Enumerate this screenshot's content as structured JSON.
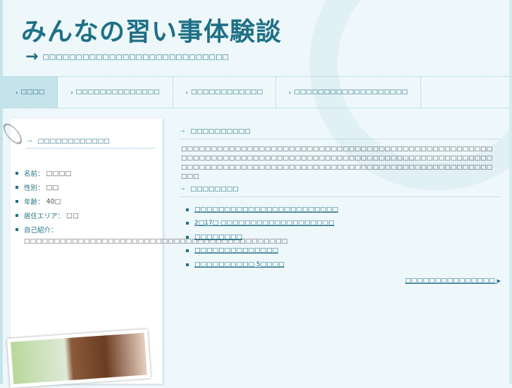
{
  "site": {
    "title": "みんなの習い事体験談",
    "tagline": "□□□□□□□□□□□□□□□□□□□□□□□□□□□□"
  },
  "nav": [
    {
      "label": "□□□□"
    },
    {
      "label": "□□□□□□□□□□□□□□"
    },
    {
      "label": "□□□□□□□□□□□□"
    },
    {
      "label": "□□□□□□□□□□□□□□□□□□□"
    }
  ],
  "profile": {
    "heading": "□□□□□□□□□□□□",
    "fields": [
      {
        "label": "名前：",
        "value": "□□□□"
      },
      {
        "label": "性別：",
        "value": "□□"
      },
      {
        "label": "年齢：",
        "value": "40□"
      },
      {
        "label": "居住エリア：",
        "value": "□□"
      },
      {
        "label": "自己紹介：",
        "value": ""
      }
    ],
    "intro": "□□□□□□□□□□□□□□□□□□□□□□□□□□□□□□□□□□□□□□□□□□□□"
  },
  "about": {
    "heading": "□□□□□□□□□□",
    "text": "□□□□□□□□□□□□□□□□□□□□□□□□□□□□□□□□□□□□□□□□□□□□□□□□□□□□□□□□□□□□□□□□□□□□□□□□□□□□□□□□□□□□□□□□□□□□□□□□□□□□□□□□□□□□□□□□□□□□□□□□□□□□□□□□□□□□□□□□□□□□□□□□□□□□□□□□□□□□□□□"
  },
  "news": {
    "heading": "□□□□□□□□",
    "items": [
      "□□□□□□□□□□□□□□□□□□□□□□□□",
      "2□17□ □□□□□□□□□□□□□□□□□□□",
      "□□□□□□□□",
      "□□□□□□□□□□□□□□",
      "□□□□□□□□□□ 5□□□□"
    ],
    "more": "□□□□□□□□□□□□□□□"
  }
}
